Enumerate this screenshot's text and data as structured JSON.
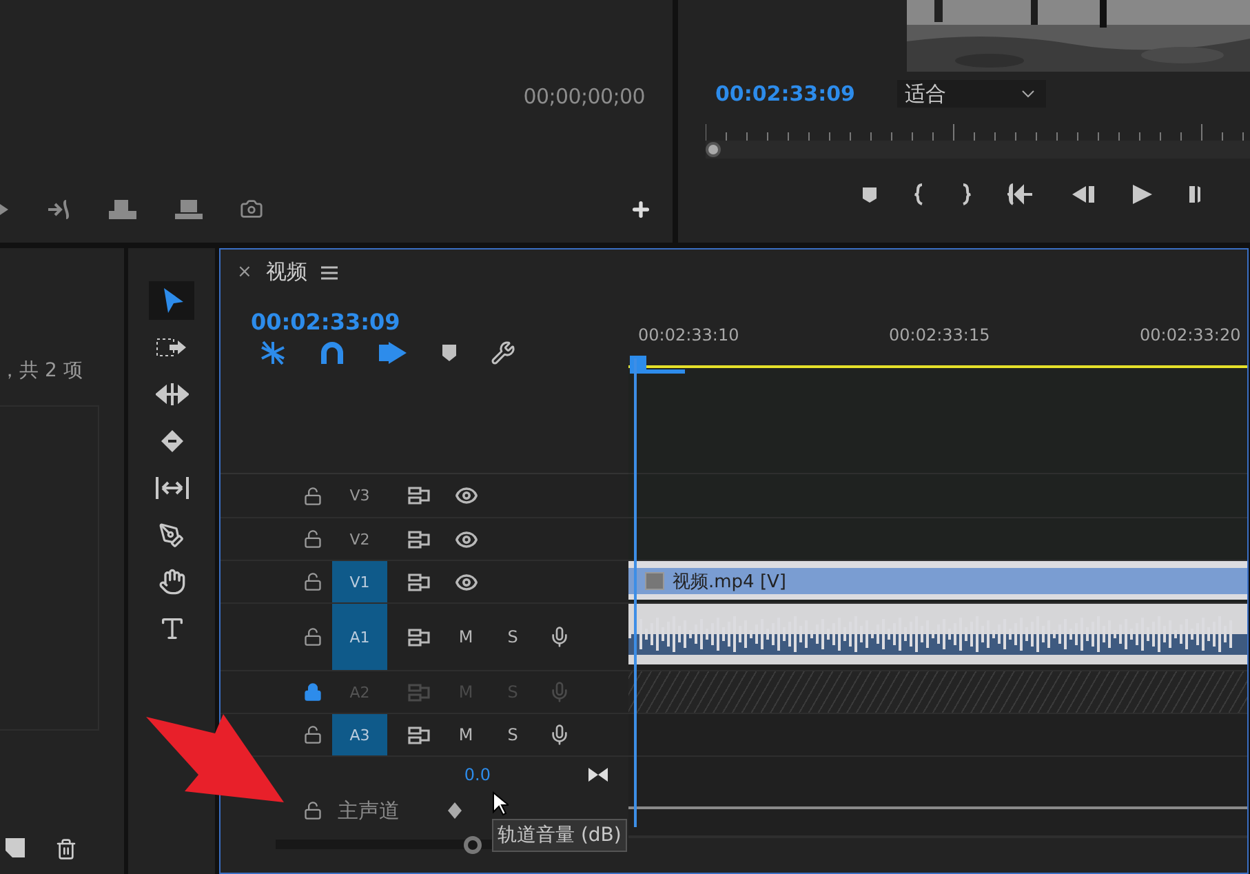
{
  "source_monitor": {
    "timecode": "00;00;00;00"
  },
  "program_monitor": {
    "timecode": "00:02:33:09",
    "zoom": "适合",
    "scrub": {
      "level": 0
    }
  },
  "project_panel": {
    "summary": "，共 2 项"
  },
  "tools": [
    {
      "kind": "selection",
      "selected": true
    },
    {
      "kind": "track-select",
      "selected": false
    },
    {
      "kind": "ripple",
      "selected": false
    },
    {
      "kind": "razor",
      "selected": false
    },
    {
      "kind": "slip",
      "selected": false
    },
    {
      "kind": "pen",
      "selected": false
    },
    {
      "kind": "hand",
      "selected": false
    },
    {
      "kind": "type",
      "selected": false
    }
  ],
  "timeline": {
    "tab": "视频",
    "tab_close": "×",
    "timecode": "00:02:33:09",
    "toggles": [
      {
        "kind": "nest",
        "on": true
      },
      {
        "kind": "snap",
        "on": true
      },
      {
        "kind": "linked",
        "on": true
      },
      {
        "kind": "marker"
      },
      {
        "kind": "settings"
      }
    ],
    "ruler": [
      "00:02:33:10",
      "00:02:33:15",
      "00:02:33:20"
    ],
    "tracks": [
      {
        "kind": "video",
        "label": "V3",
        "targeted": false,
        "locked": false
      },
      {
        "kind": "video",
        "label": "V2",
        "targeted": false,
        "locked": false
      },
      {
        "kind": "video",
        "label": "V1",
        "targeted": true,
        "locked": false,
        "clip": "视频.mp4 [V]"
      },
      {
        "kind": "audio",
        "label": "A1",
        "targeted": true,
        "locked": false,
        "mute": "M",
        "solo": "S",
        "waveform": true
      },
      {
        "kind": "audio",
        "label": "A2",
        "targeted": false,
        "locked": true,
        "mute": "M",
        "solo": "S"
      },
      {
        "kind": "audio",
        "label": "A3",
        "targeted": true,
        "locked": false,
        "mute": "M",
        "solo": "S"
      }
    ]
  },
  "master": {
    "label": "主声道",
    "volume": "0.0"
  },
  "tooltip": "轨道音量 (dB)"
}
